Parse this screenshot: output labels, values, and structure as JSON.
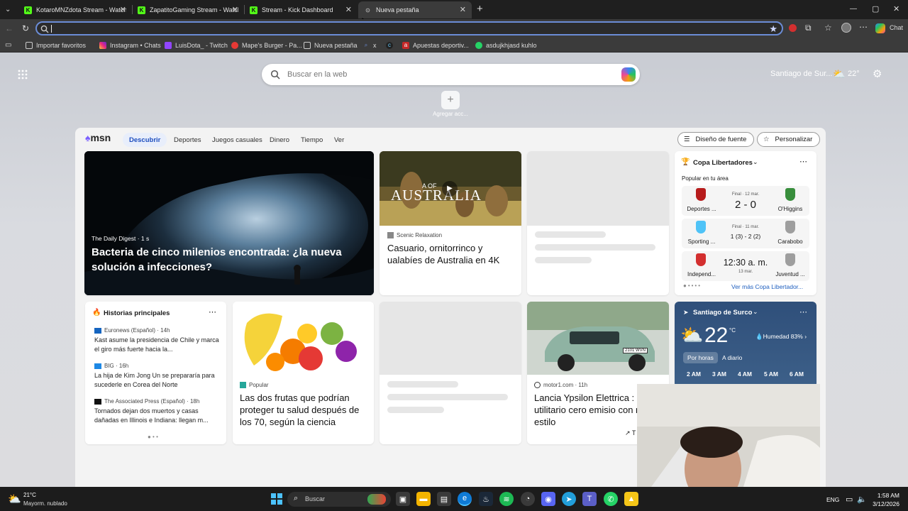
{
  "browser": {
    "tabs": [
      {
        "title": "KotaroMNZdota Stream - Watch L",
        "icon": "K"
      },
      {
        "title": "ZapatitoGaming Stream - Watch L",
        "icon": "K"
      },
      {
        "title": "Stream - Kick Dashboard",
        "icon": "K"
      },
      {
        "title": "Nueva pestaña",
        "icon": "⊙"
      }
    ],
    "chat_label": "Chat",
    "bookmarks": [
      "Importar favoritos",
      "Instagram • Chats",
      "LuisDota_ - Twitch",
      "Mape's Burger - Pa...",
      "Nueva pestaña",
      "x",
      "Apuestas deportiv...",
      "asdujkhjasd kuhlo"
    ]
  },
  "newtab": {
    "search_placeholder": "Buscar en la web",
    "add_shortcut_label": "Agregar acc...",
    "weather_location": "Santiago de Sur...",
    "weather_temp": "22°"
  },
  "msn": {
    "logo": "msn",
    "nav": [
      "Descubrir",
      "Deportes",
      "Juegos casuales",
      "Dinero",
      "Tiempo",
      "Ver"
    ],
    "font_button": "Diseño de fuente",
    "personalize_button": "Personalizar",
    "hero": {
      "source": "The Daily Digest",
      "age": "1 s",
      "title": "Bacteria de cinco milenios encontrada: ¿la nueva solución a infecciones?"
    },
    "australia": {
      "overlay": "AUSTRALIA",
      "overlay_small": "A",
      "overlay_small2": "OF",
      "source": "Scenic Relaxation",
      "title": "Casuario, ornitorrinco y ualabíes de Australia en 4K"
    },
    "copa": {
      "title": "Copa Libertadores",
      "subtitle": "Popular en tu área",
      "matches": [
        {
          "home": "Deportes ...",
          "away": "O'Higgins",
          "status": "Final · 12 mar.",
          "score": "2 - 0"
        },
        {
          "home": "Sporting ...",
          "away": "Carabobo",
          "status": "Final · 11 mar.",
          "score": "1 (3) - 2 (2)"
        },
        {
          "home": "Independ...",
          "away": "Juventud ...",
          "status": "13 mar.",
          "score": "12:30 a. m."
        }
      ],
      "more": "Ver más Copa Libertador..."
    },
    "top_stories": {
      "title": "Historias principales",
      "items": [
        {
          "source": "Euronews (Español) · 14h",
          "title": "Kast asume la presidencia de Chile y marca el giro más fuerte hacia la..."
        },
        {
          "source": "BIG · 16h",
          "title": "La hija de Kim Jong Un se prepararía para sucederle en Corea del Norte"
        },
        {
          "source": "The Associated Press (Español) · 18h",
          "title": "Tornados dejan dos muertos y casas dañadas en Illinois e Indiana: llegan m..."
        }
      ]
    },
    "fruits": {
      "source": "Popular",
      "title": "Las dos frutas que podrían proteger tu salud después de los 70, según la ciencia"
    },
    "car": {
      "source": "motor1.com · 11h",
      "title": "Lancia Ypsilon Elettrica : un utilitario cero emisio con mucho estilo",
      "plate": "2101 WVN",
      "trend": "T"
    },
    "weather": {
      "location": "Santiago de Surco",
      "temp": "22",
      "unit": "°C",
      "humidity": "Humedad 83%",
      "tabs": [
        "Por horas",
        "A diario"
      ],
      "hours": [
        "2 AM",
        "3 AM",
        "4 AM",
        "5 AM",
        "6 AM"
      ]
    }
  },
  "taskbar": {
    "weather_temp": "21°C",
    "weather_desc": "Mayorm. nublado",
    "search_label": "Buscar",
    "lang": "ENG",
    "time": "1:58 AM",
    "date": "3/12/2026"
  }
}
